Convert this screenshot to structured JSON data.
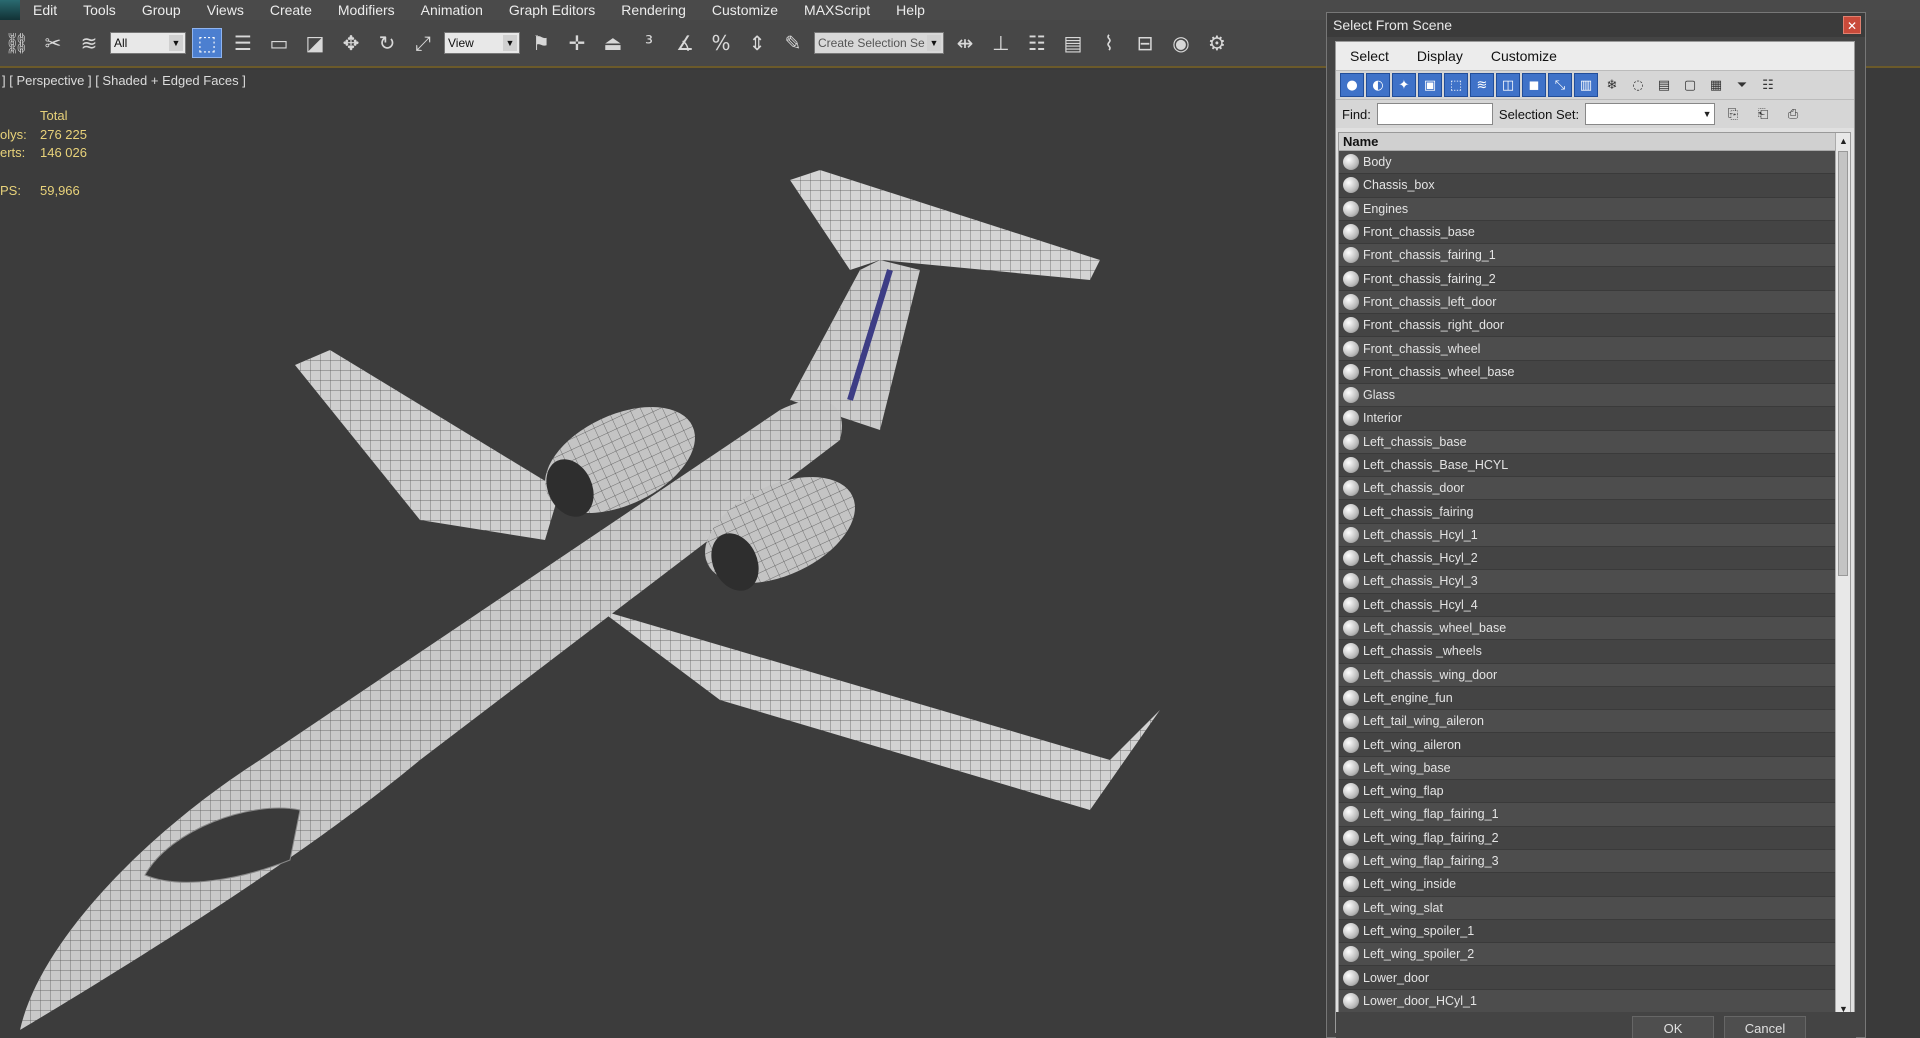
{
  "menubar": {
    "items": [
      "Edit",
      "Tools",
      "Group",
      "Views",
      "Create",
      "Modifiers",
      "Animation",
      "Graph Editors",
      "Rendering",
      "Customize",
      "MAXScript",
      "Help"
    ]
  },
  "toolbar": {
    "filter_value": "All",
    "coord_value": "View",
    "selection_set_placeholder": "Create Selection Se"
  },
  "viewport": {
    "label": "] [ Perspective ] [ Shaded + Edged Faces ]",
    "stats": {
      "header": "Total",
      "polys_label": "olys:",
      "polys_value": "276 225",
      "verts_label": "erts:",
      "verts_value": "146 026",
      "fps_label": "PS:",
      "fps_value": "59,966"
    }
  },
  "dialog": {
    "title": "Select From Scene",
    "close": "✕",
    "menus": [
      "Select",
      "Display",
      "Customize"
    ],
    "find_label": "Find:",
    "selection_set_label": "Selection Set:",
    "list_header": "Name",
    "items": [
      "Body",
      "Chassis_box",
      "Engines",
      "Front_chassis_base",
      "Front_chassis_fairing_1",
      "Front_chassis_fairing_2",
      "Front_chassis_left_door",
      "Front_chassis_right_door",
      "Front_chassis_wheel",
      "Front_chassis_wheel_base",
      "Glass",
      "Interior",
      "Left_chassis_base",
      "Left_chassis_Base_HCYL",
      "Left_chassis_door",
      "Left_chassis_fairing",
      "Left_chassis_Hcyl_1",
      "Left_chassis_Hcyl_2",
      "Left_chassis_Hcyl_3",
      "Left_chassis_Hcyl_4",
      "Left_chassis_wheel_base",
      "Left_chassis _wheels",
      "Left_chassis_wing_door",
      "Left_engine_fun",
      "Left_tail_wing_aileron",
      "Left_wing_aileron",
      "Left_wing_base",
      "Left_wing_flap",
      "Left_wing_flap_fairing_1",
      "Left_wing_flap_fairing_2",
      "Left_wing_flap_fairing_3",
      "Left_wing_inside",
      "Left_wing_slat",
      "Left_wing_spoiler_1",
      "Left_wing_spoiler_2",
      "Lower_door",
      "Lower_door_HCyl_1"
    ],
    "ok_label": "OK",
    "cancel_label": "Cancel"
  }
}
